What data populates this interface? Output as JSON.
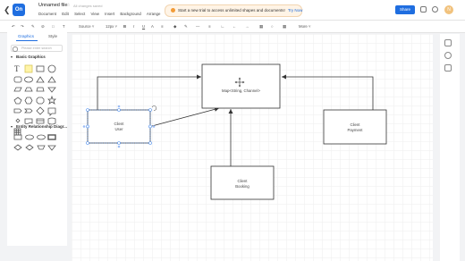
{
  "header": {
    "title": "Unnamed file",
    "saved_status": "All changes saved",
    "menu": [
      "Document",
      "Edit",
      "Select",
      "View",
      "Insert",
      "Background",
      "Arrange"
    ],
    "promo_text": "Start a new trial to access unlimited shapes and documents!",
    "promo_cta": "Try Now",
    "share_label": "Share",
    "avatar_initial": "N"
  },
  "toolbar": {
    "font": "Source",
    "size": "12px",
    "more": "More"
  },
  "left_panel": {
    "tab_graphics": "Graphics",
    "tab_style": "Style",
    "search_placeholder": "Please enter search",
    "section_basic": "Basic Graphics",
    "section_er": "Entity Relationship Diagr..."
  },
  "diagram": {
    "map_box": "Map<String, Channel>",
    "client_user": [
      "Client",
      "User"
    ],
    "client_payment": [
      "Client",
      "Payment"
    ],
    "client_booking": [
      "Client",
      "Booking"
    ]
  },
  "colors": {
    "accent": "#1f6ee0",
    "selection": "#4a8df0",
    "promo_bg": "#fff4e6"
  }
}
